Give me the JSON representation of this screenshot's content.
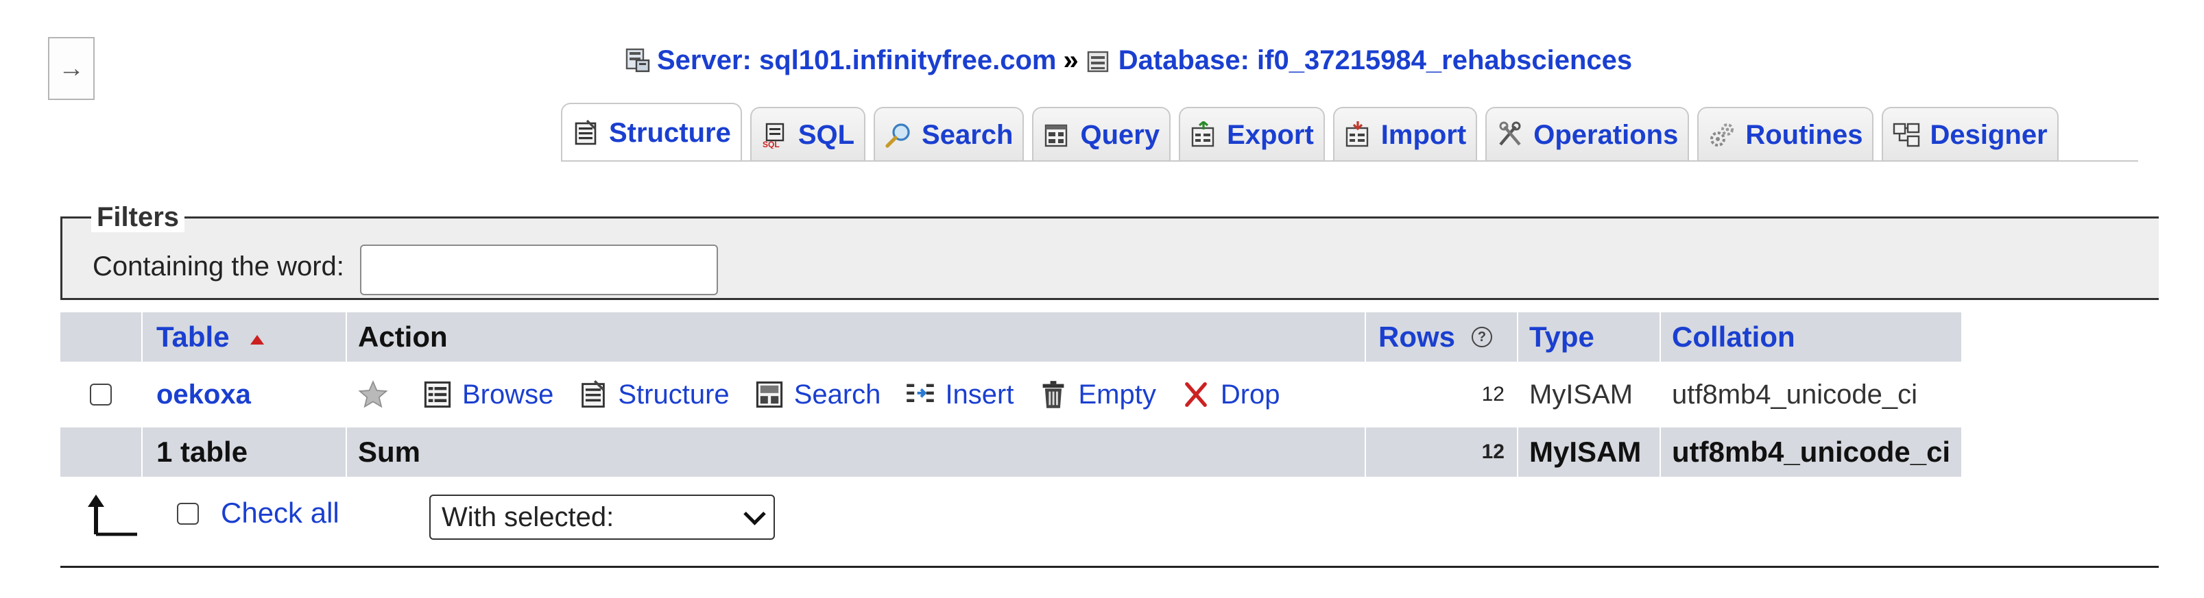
{
  "nav": {
    "toggle_glyph": "→"
  },
  "breadcrumb": {
    "server": "Server: sql101.infinityfree.com",
    "separator": "»",
    "database": "Database: if0_37215984_rehabsciences"
  },
  "tabs": [
    {
      "label": "Structure",
      "icon": "structure-icon",
      "active": true
    },
    {
      "label": "SQL",
      "icon": "sql-icon"
    },
    {
      "label": "Search",
      "icon": "search-icon"
    },
    {
      "label": "Query",
      "icon": "query-icon"
    },
    {
      "label": "Export",
      "icon": "export-icon"
    },
    {
      "label": "Import",
      "icon": "import-icon"
    },
    {
      "label": "Operations",
      "icon": "operations-icon"
    },
    {
      "label": "Routines",
      "icon": "routines-icon"
    },
    {
      "label": "Designer",
      "icon": "designer-icon"
    }
  ],
  "filters": {
    "legend": "Filters",
    "label": "Containing the word:",
    "value": ""
  },
  "table": {
    "headers": {
      "table": "Table",
      "action": "Action",
      "rows": "Rows",
      "type": "Type",
      "collation": "Collation"
    },
    "rows": [
      {
        "name": "oekoxa",
        "actions": {
          "browse": "Browse",
          "structure": "Structure",
          "search": "Search",
          "insert": "Insert",
          "empty": "Empty",
          "drop": "Drop"
        },
        "rows": "12",
        "type": "MyISAM",
        "collation": "utf8mb4_unicode_ci"
      }
    ],
    "footer": {
      "count": "1 table",
      "sum": "Sum",
      "rows": "12",
      "type": "MyISAM",
      "collation": "utf8mb4_unicode_ci"
    }
  },
  "bottom": {
    "check_all": "Check all",
    "with_selected": "With selected:"
  },
  "colors": {
    "link": "#1a3fd0",
    "header_bg": "#d6d9df",
    "filters_bg": "#eeeeee",
    "sort_arrow": "#cc1f1f"
  }
}
